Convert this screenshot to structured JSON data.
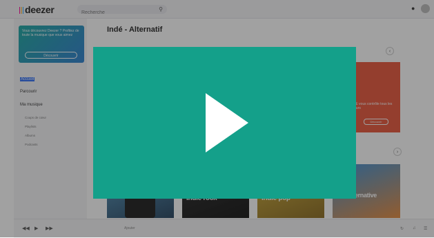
{
  "topbar": {
    "logo": "deezer",
    "search_placeholder": "Recherche",
    "search_icon": "search-icon",
    "bell_icon": "bell-icon"
  },
  "sidebar": {
    "promo_text": "Vous découvrez Deezer ? Profitez de toute la musique que vous aimez",
    "promo_button": "Découvrir",
    "nav": [
      {
        "label": "Accueil",
        "active": true
      },
      {
        "label": "Parcourir"
      },
      {
        "label": "Ma musique"
      }
    ],
    "subnav": [
      "Coups de cœur",
      "Playlists",
      "Albums",
      "Podcasts"
    ]
  },
  "main": {
    "title": "Indé - Alternatif",
    "banner_text": "PE vous contrôle tous les jours",
    "banner_button": "Découvrir",
    "cards": [
      {
        "label": ""
      },
      {
        "label": "Indie rock"
      },
      {
        "label": "Indie pop"
      },
      {
        "label": "Hot alternative"
      }
    ]
  },
  "player": {
    "track": "Ajouter"
  },
  "overlay": {
    "color": "#14a08a",
    "icon": "play-icon"
  }
}
